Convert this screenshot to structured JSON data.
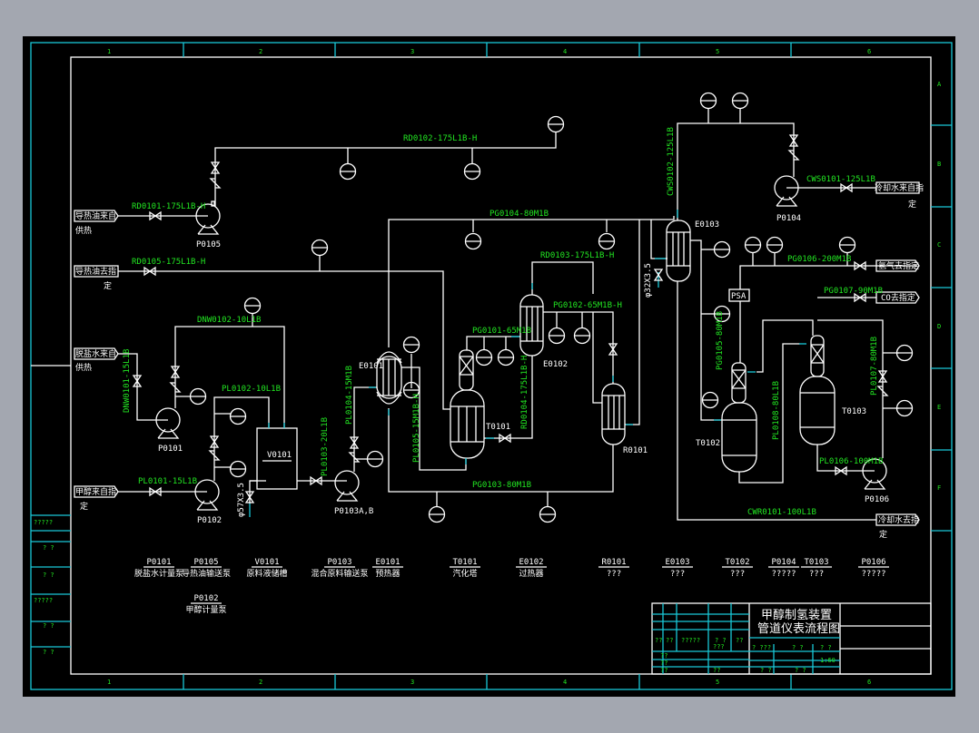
{
  "grid": {
    "columns": [
      "1",
      "2",
      "3",
      "4",
      "5",
      "6"
    ],
    "rows": [
      "A",
      "B",
      "C",
      "D",
      "E",
      "F"
    ]
  },
  "lines": {
    "rd0102": "RD0102-175L1B-H",
    "rd0101": "RD0101-175L1B-H",
    "rd0105": "RD0105-175L1B-H",
    "dnw0102": "DNW0102-10L1B",
    "dnw0101": "DNW0101-15L1B",
    "pl0102": "PL0102-10L1B",
    "pl0101": "PL0101-15L1B",
    "pl0103": "PL0103-20L1B",
    "pl0104": "PL0104-15M1B",
    "pl0105": "PL0105-15M1B-H",
    "pg0104": "PG0104-80M1B",
    "pg0101": "PG0101-65M1B",
    "rd0103": "RD0103-175L1B-H",
    "pg0102": "PG0102-65M1B-H",
    "rd0104": "RD0104-175L1B-H",
    "pg0103": "PG0103-80M1B",
    "cws0102": "CWS0102-125L1B",
    "cws0101": "CWS0101-125L1B",
    "pg0106": "PG0106-200M1B",
    "pg0107": "PG0107-90M1B",
    "pg0105": "PG0105-80M1B",
    "pl0108": "PL0108-80L1B",
    "pl0107": "PL0107-80M1B",
    "pl0106": "PL0106-100M1B",
    "cwr0101": "CWR0101-100L1B",
    "drain1": "φ57X3.5",
    "drain2": "φ32X3.5"
  },
  "equipment": {
    "p0105": "P0105",
    "p0101": "P0101",
    "p0102": "P0102",
    "p0103": "P0103A,B",
    "v0101": "V0101",
    "e0101": "E0101",
    "t0101": "T0101",
    "e0102": "E0102",
    "r0101": "R0101",
    "e0103": "E0103",
    "p0104": "P0104",
    "t0102": "T0102",
    "t0103": "T0103",
    "p0106": "P0106",
    "psa": "PSA"
  },
  "terminals": {
    "hot_oil_in": "导热油来自",
    "hot_oil_in_2": "供热",
    "hot_oil_out": "导热油去指",
    "hot_oil_out_2": "定",
    "water_in": "脱盐水来自",
    "water_in_2": "供热",
    "methanol_in": "甲醇来自指",
    "methanol_in_2": "定",
    "cw_in": "冷却水来自指",
    "cw_in_2": "定",
    "h2_out": "氢气去指定",
    "co_out": "CO去指定",
    "cw_out": "冷却水去指",
    "cw_out_2": "定"
  },
  "equipment_list": [
    {
      "tag": "P0101",
      "name": "脱盐水计量泵"
    },
    {
      "tag": "P0105",
      "name": "导热油输送泵"
    },
    {
      "tag": "V0101",
      "name": "原料液储槽"
    },
    {
      "tag": "P0103",
      "name": "混合原料输送泵"
    },
    {
      "tag": "E0101",
      "name": "预热器"
    },
    {
      "tag": "T0101",
      "name": "汽化塔"
    },
    {
      "tag": "E0102",
      "name": "过热器"
    },
    {
      "tag": "R0101",
      "name": "???"
    },
    {
      "tag": "E0103",
      "name": "???"
    },
    {
      "tag": "T0102",
      "name": "???"
    },
    {
      "tag": "P0104",
      "name": "?????"
    },
    {
      "tag": "T0103",
      "name": "???"
    },
    {
      "tag": "P0106",
      "name": "?????"
    },
    {
      "tag": "P0102",
      "name": "甲醇计量泵"
    }
  ],
  "left_strip": [
    "?????",
    "? ?",
    "? ?",
    "?????",
    "? ?",
    "? ?"
  ],
  "title_block": {
    "title_line1": "甲醇制氢装置",
    "title_line2": "管道仪表流程图",
    "scale": "1:60",
    "cells": [
      "??",
      "??",
      "?????",
      "? ?",
      "??",
      "??",
      "???",
      "? ???",
      "? ?",
      "? ?",
      "??",
      "??",
      "??",
      "? ?",
      "? ?"
    ]
  },
  "colors": {
    "background": "#000000",
    "pipe": "#ffffff",
    "label": "#22e622",
    "frame": "#19c8d8",
    "outer": "#a3a7b0"
  }
}
